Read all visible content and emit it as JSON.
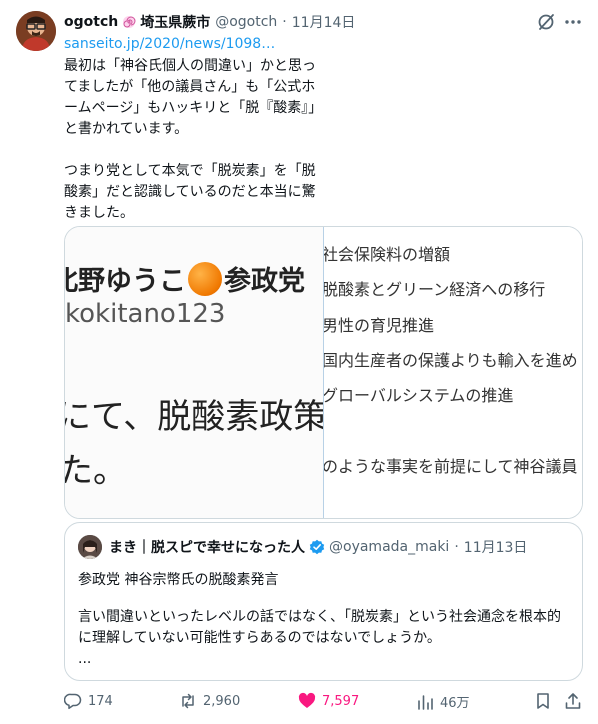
{
  "tweet": {
    "author_name": "ogotch",
    "location": "埼玉県蕨市",
    "handle": "@ogotch",
    "separator": "·",
    "date": "11月14日",
    "link": "sanseito.jp/2020/news/1098…",
    "body": "最初は「神谷氏個人の間違い」かと思ってましたが「他の議員さん」も「公式ホームページ」もハッキリと「脱『酸素』」と書かれています。\n\nつまり党として本気で「脱炭素」を「脱酸素」だと認識しているのだと本当に驚きました。"
  },
  "media": {
    "left": {
      "name": "北野ゆうこ",
      "party": "参政党",
      "handle": "kokitano123",
      "big_line1": "にて、脱酸素政策",
      "big_line2": "た。"
    },
    "right_lines": [
      "社会保険料の増額",
      "脱酸素とグリーン経済への移行",
      "男性の育児推進",
      "国内生産者の保護よりも輸入を進め",
      "グローバルシステムの推進",
      "のような事実を前提にして神谷議員"
    ]
  },
  "quote": {
    "name": "まき｜脱スピで幸せになった人",
    "handle": "@oyamada_maki",
    "separator": "·",
    "date": "11月13日",
    "title": "参政党 神谷宗幣氏の脱酸素発言",
    "text": "言い間違いといったレベルの話ではなく、「脱炭素」という社会通念を根本的に理解していない可能性すらあるのではないでしょうか。",
    "more": "..."
  },
  "actions": {
    "replies": "174",
    "reposts": "2,960",
    "likes": "7,597",
    "views": "46万"
  },
  "colors": {
    "link": "#1d9bf0",
    "like": "#f91880",
    "muted": "#536471",
    "border": "#cfd9de"
  }
}
